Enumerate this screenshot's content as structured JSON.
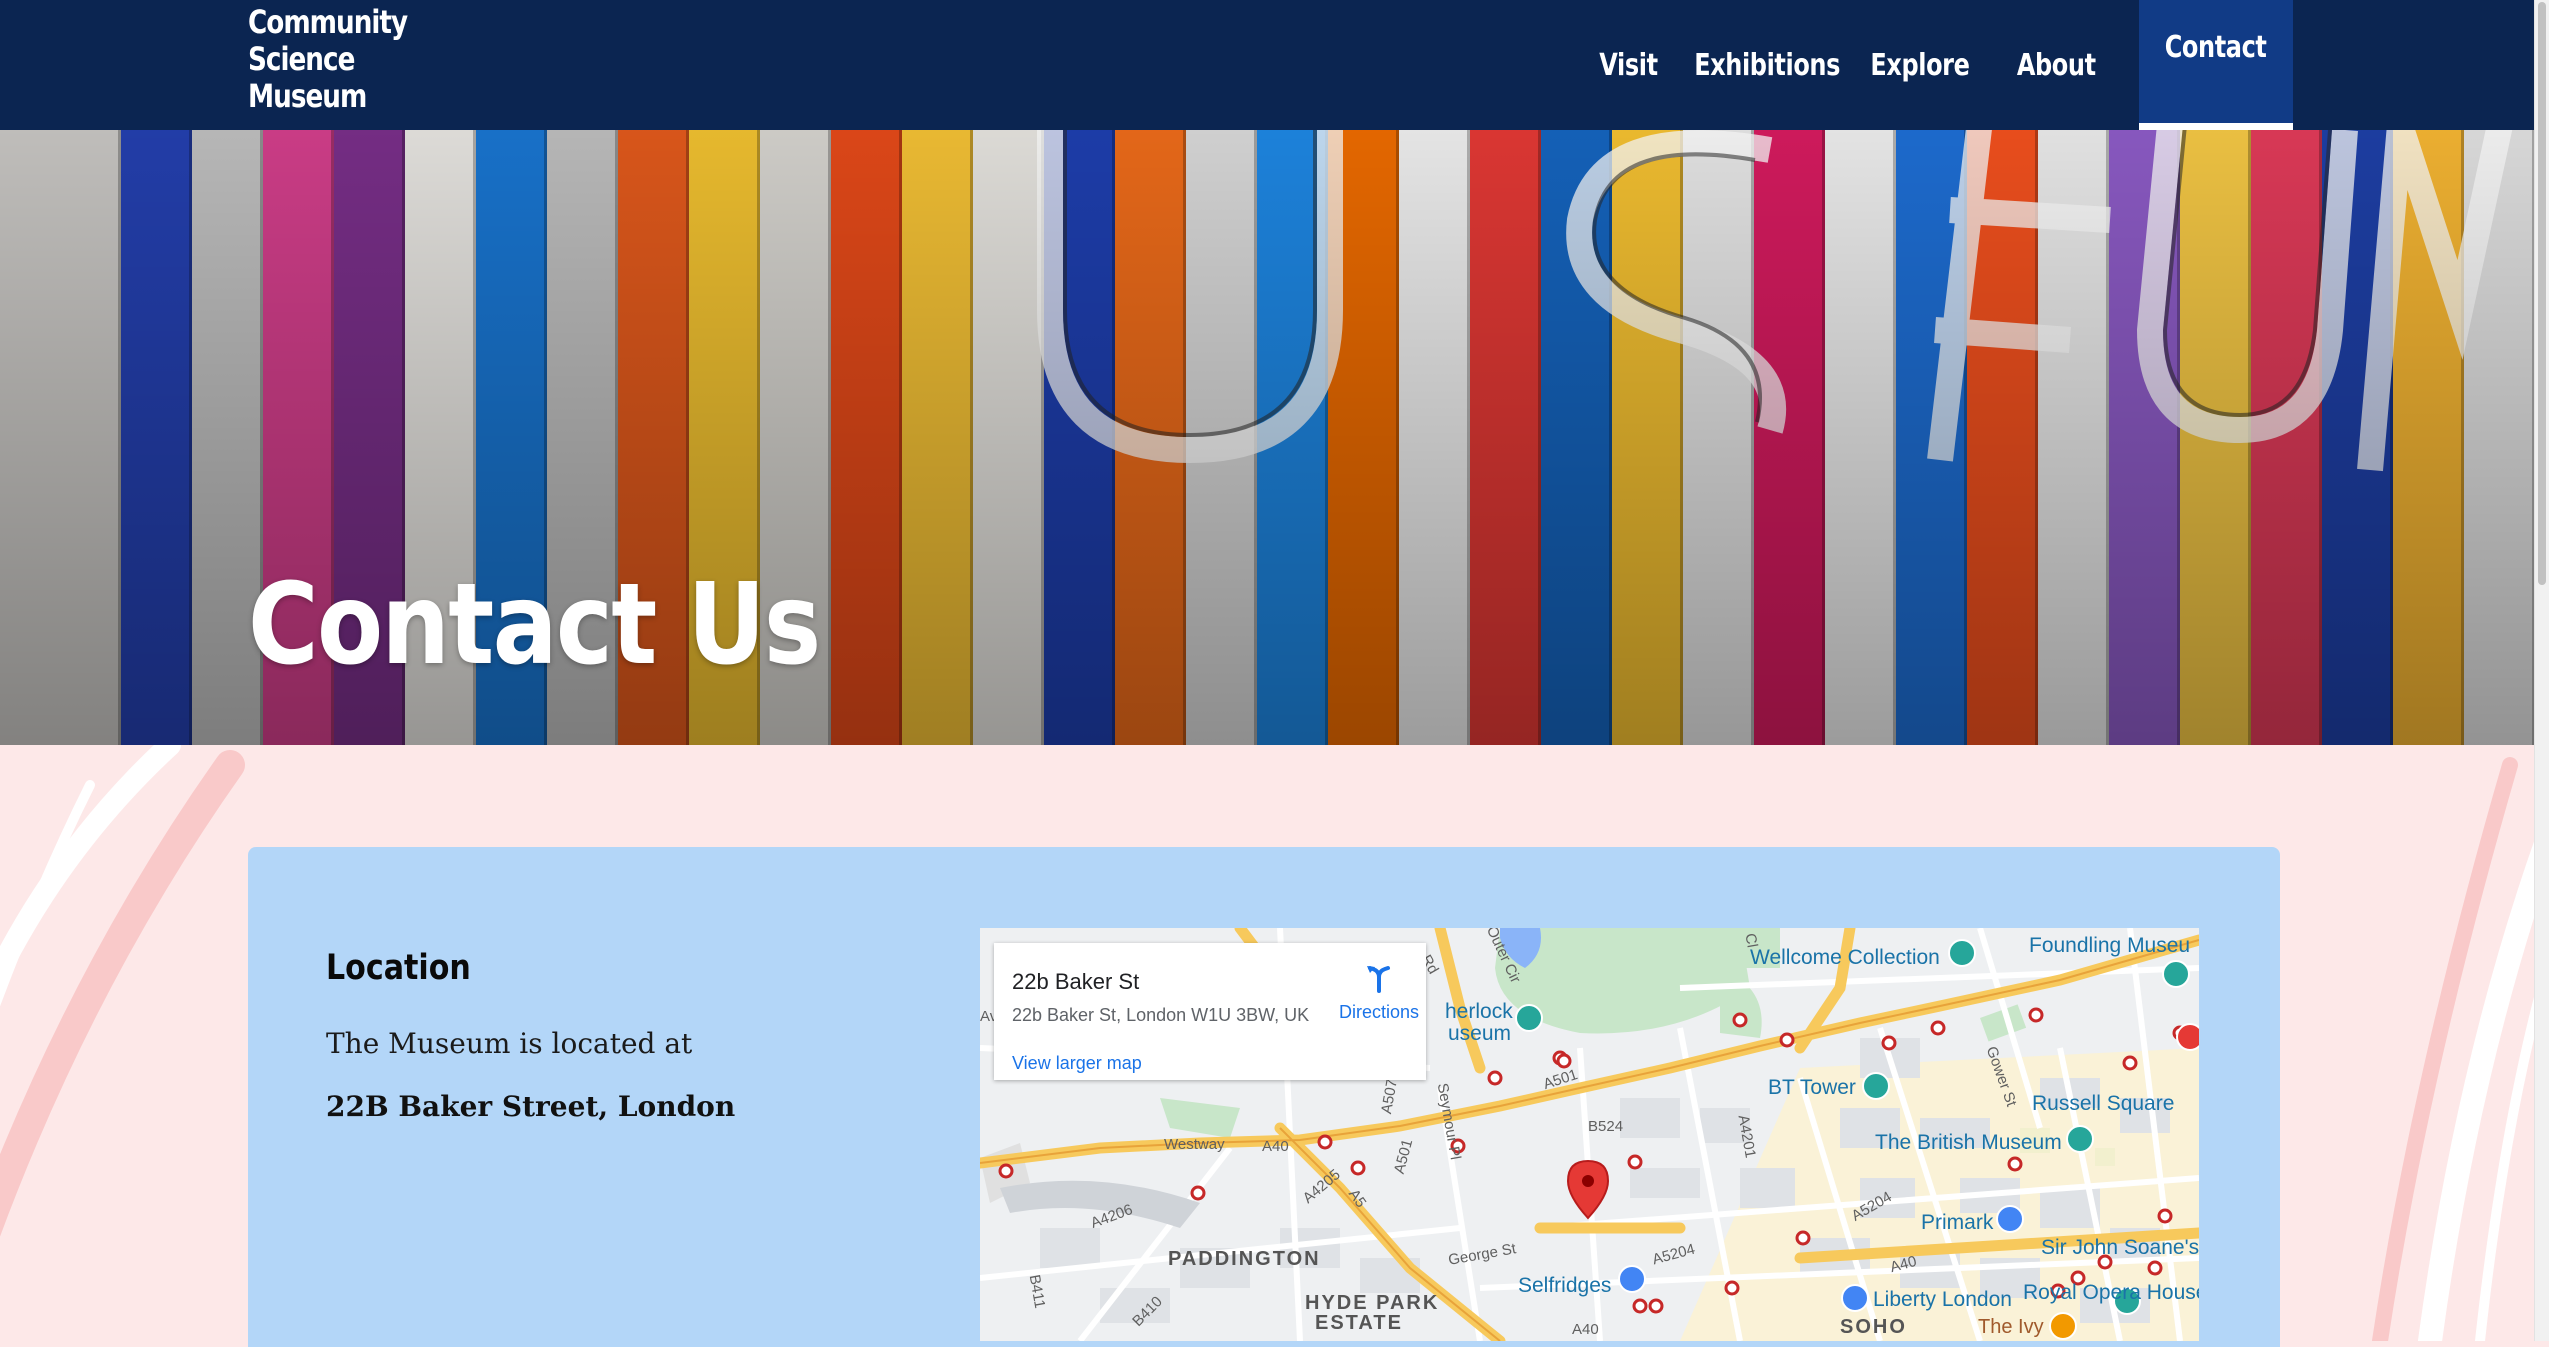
{
  "header": {
    "logo_lines": [
      "Community",
      "Science",
      "Museum"
    ],
    "nav": [
      {
        "label": "Visit"
      },
      {
        "label": "Exhibitions"
      },
      {
        "label": "Explore"
      },
      {
        "label": "About"
      },
      {
        "label": "Contact",
        "active": true
      }
    ]
  },
  "hero": {
    "title": "Contact Us",
    "image_semantic": "colorful-museum-facade-letters"
  },
  "location": {
    "heading": "Location",
    "text": "The Museum is located at",
    "address": "22B Baker Street, London"
  },
  "map": {
    "place_name": "22b Baker St",
    "place_address": "22b Baker St, London W1U 3BW, UK",
    "directions_label": "Directions",
    "larger_map_label": "View larger map",
    "pois": [
      "Wellcome Collection",
      "Foundling Museu",
      "herlock",
      "useum",
      "BT Tower",
      "Russell Square",
      "The British Museum",
      "Primark",
      "Sir John Soane's",
      "Selfridges",
      "Liberty London",
      "Royal Opera House",
      "The Ivy"
    ],
    "districts": [
      "PADDINGTON",
      "HYDE PARK",
      "ESTATE",
      "SOHO"
    ],
    "roads": [
      "A501",
      "B524",
      "A40",
      "Westway",
      "A4206",
      "A4205",
      "A5",
      "A501",
      "George St",
      "A5204",
      "A4201",
      "Gower St",
      "A5204",
      "A40",
      "B411",
      "B410",
      "Seymour Pl",
      "Outer Cir",
      "Rd",
      "Av",
      "A507",
      "Cl",
      "A40"
    ]
  },
  "colors": {
    "header_bg": "#0b2551",
    "nav_active_bg": "#113b86",
    "card_bg": "#b3d6f8",
    "band_bg": "#fde8e8",
    "map_pin": "#e53935"
  }
}
